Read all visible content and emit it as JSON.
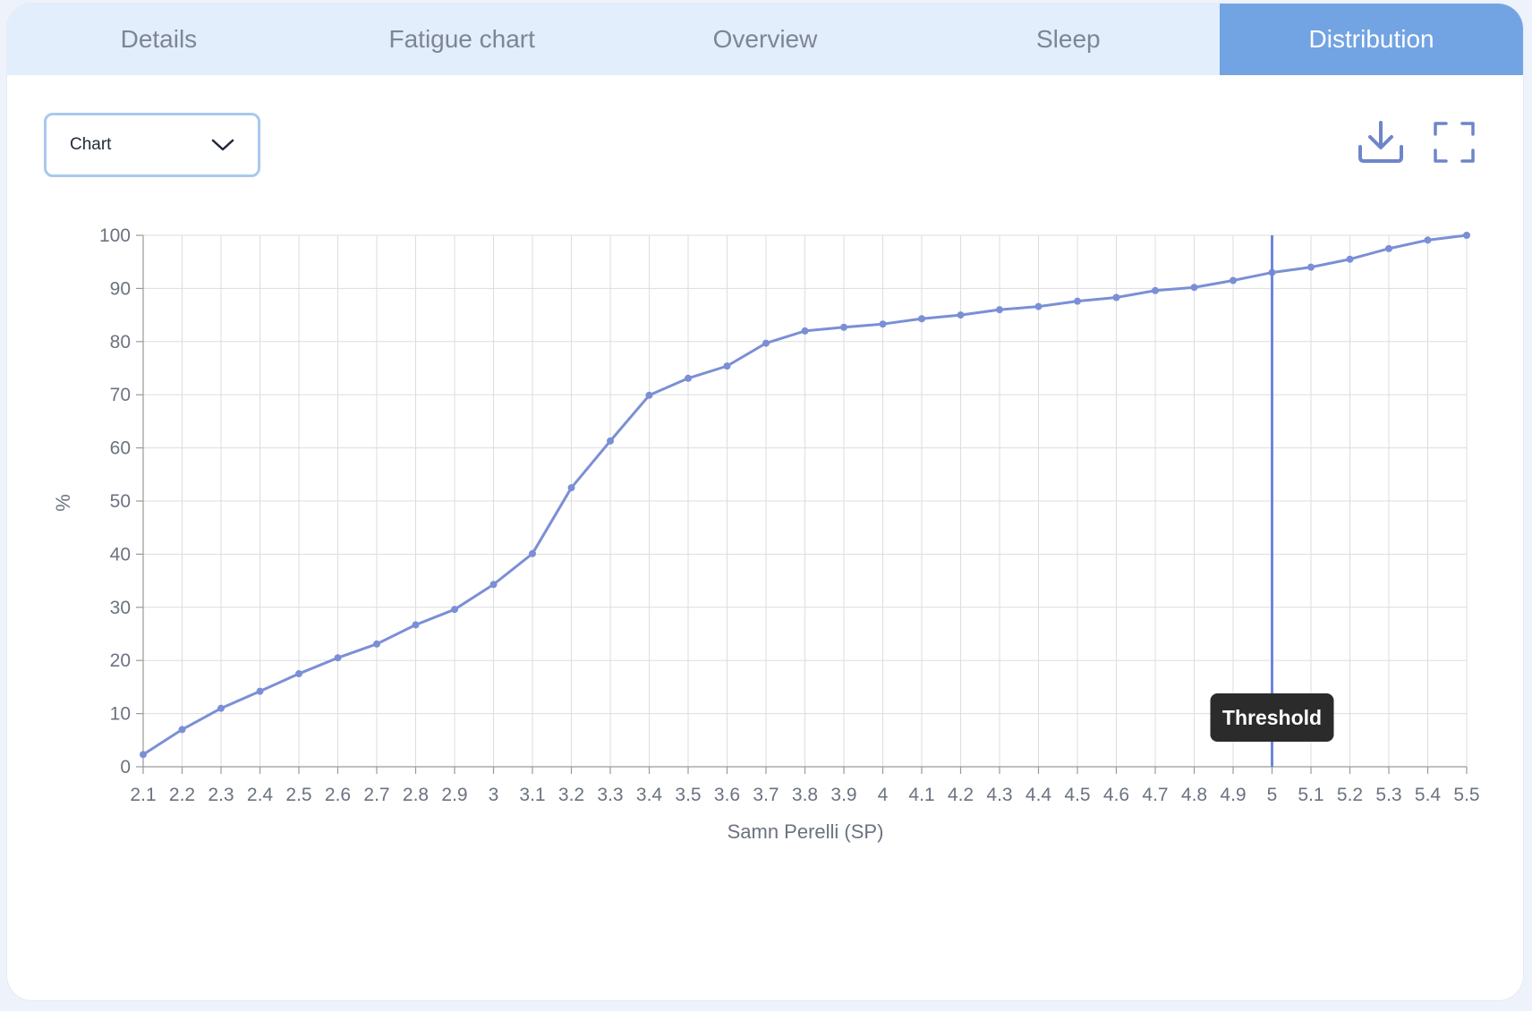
{
  "tabs": [
    {
      "label": "Details",
      "active": false
    },
    {
      "label": "Fatigue chart",
      "active": false
    },
    {
      "label": "Overview",
      "active": false
    },
    {
      "label": "Sleep",
      "active": false
    },
    {
      "label": "Distribution",
      "active": true
    }
  ],
  "view_select": {
    "value": "Chart"
  },
  "toolbar": {
    "download_icon": "download-icon",
    "fullscreen_icon": "fullscreen-icon"
  },
  "colors": {
    "accent": "#72a3e3",
    "line": "#7b8fd6",
    "threshold": "#6f86d8"
  },
  "chart_data": {
    "type": "line",
    "xlabel": "Samn Perelli (SP)",
    "ylabel": "%",
    "x": [
      2.1,
      2.2,
      2.3,
      2.4,
      2.5,
      2.6,
      2.7,
      2.8,
      2.9,
      3,
      3.1,
      3.2,
      3.3,
      3.4,
      3.5,
      3.6,
      3.7,
      3.8,
      3.9,
      4,
      4.1,
      4.2,
      4.3,
      4.4,
      4.5,
      4.6,
      4.7,
      4.8,
      4.9,
      5,
      5.1,
      5.2,
      5.3,
      5.4,
      5.5
    ],
    "x_tick_labels": [
      "2.1",
      "2.2",
      "2.3",
      "2.4",
      "2.5",
      "2.6",
      "2.7",
      "2.8",
      "2.9",
      "3",
      "3.1",
      "3.2",
      "3.3",
      "3.4",
      "3.5",
      "3.6",
      "3.7",
      "3.8",
      "3.9",
      "4",
      "4.1",
      "4.2",
      "4.3",
      "4.4",
      "4.5",
      "4.6",
      "4.7",
      "4.8",
      "4.9",
      "5",
      "5.1",
      "5.2",
      "5.3",
      "5.4",
      "5.5"
    ],
    "y": [
      2.3,
      7,
      11,
      14.2,
      17.5,
      20.5,
      23.1,
      26.7,
      29.6,
      34.3,
      40.1,
      52.5,
      61.3,
      69.9,
      73.1,
      75.4,
      79.7,
      82,
      82.7,
      83.3,
      84.3,
      85,
      86,
      86.6,
      87.6,
      88.3,
      89.6,
      90.2,
      91.5,
      93,
      94,
      95.5,
      97.5,
      99.1,
      100.2
    ],
    "ylim": [
      0,
      100
    ],
    "y_ticks": [
      0,
      10,
      20,
      30,
      40,
      50,
      60,
      70,
      80,
      90,
      100
    ],
    "grid": true,
    "annotations": [
      {
        "x": 5,
        "label": "Threshold"
      }
    ]
  }
}
